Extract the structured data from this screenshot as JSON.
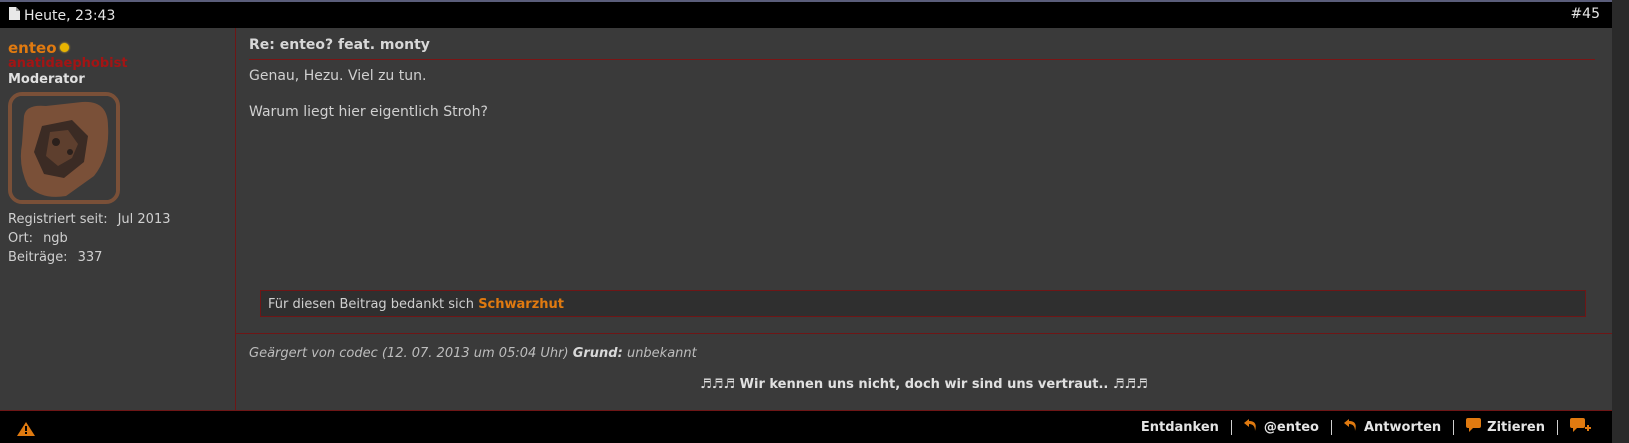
{
  "header": {
    "date": "Heute, 23:43",
    "post_number": "#45"
  },
  "user": {
    "name": "enteo",
    "title": "anatidaephobist",
    "rank": "Moderator",
    "registered_label": "Registriert seit:",
    "registered_value": "Jul 2013",
    "location_label": "Ort:",
    "location_value": "ngb",
    "posts_label": "Beiträge:",
    "posts_value": "337",
    "status_color": "#e8b400"
  },
  "post": {
    "title": "Re: enteo? feat. monty",
    "line1": "Genau, Hezu. Viel zu tun.",
    "line2": "Warum liegt hier eigentlich Stroh?",
    "thanks_text": "Für diesen Beitrag bedankt sich",
    "thanks_user": "Schwarzhut",
    "edited_text": "Geärgert von codec (12. 07. 2013 um 05:04 Uhr)",
    "reason_label": "Grund:",
    "reason_value": "unbekannt",
    "signature": "♬♬♬ Wir kennen uns nicht, doch wir sind uns vertraut.. ♬♬♬"
  },
  "footer": {
    "unthank_label": "Entdanken",
    "mention_label": "@enteo",
    "reply_label": "Antworten",
    "quote_label": "Zitieren",
    "icons": [
      "warning-icon",
      "reply-arrow-icon",
      "speech-bubble-icon",
      "speech-bubble-plus-icon"
    ]
  },
  "colors": {
    "accent": "#e07a10",
    "border": "#6e1616",
    "usertitle": "#a31414"
  }
}
